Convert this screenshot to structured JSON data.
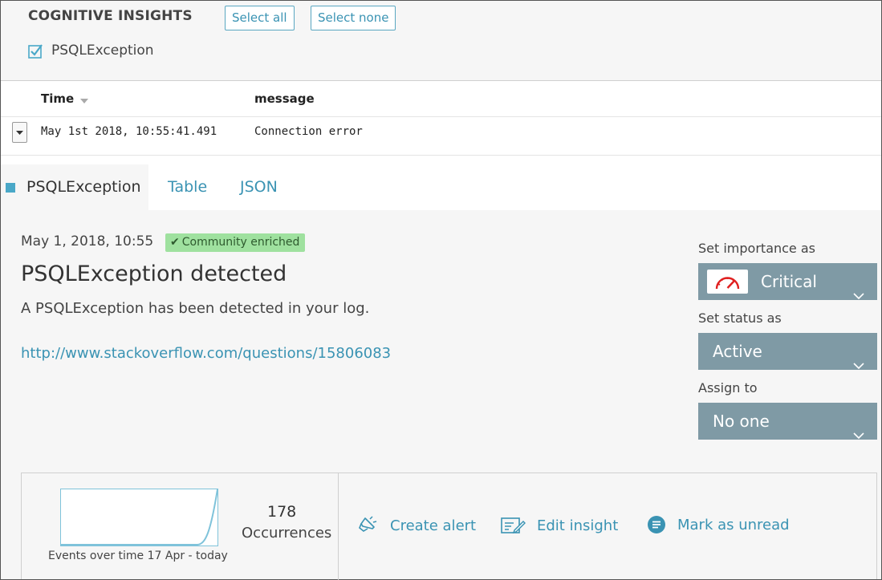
{
  "header": {
    "title": "COGNITIVE INSIGHTS",
    "select_all": "Select all",
    "select_none": "Select none",
    "filter_label": "PSQLException",
    "filter_checked": true
  },
  "log": {
    "columns": {
      "time": "Time",
      "message": "message"
    },
    "row": {
      "time": "May 1st 2018, 10:55:41.491",
      "message": "Connection error"
    }
  },
  "tabs": [
    {
      "label": "PSQLException",
      "active": true
    },
    {
      "label": "Table",
      "active": false
    },
    {
      "label": "JSON",
      "active": false
    }
  ],
  "insight": {
    "date": "May 1, 2018, 10:55",
    "badge": "Community enriched",
    "title": "PSQLException detected",
    "description": "A PSQLException has been detected in your log.",
    "link": "http://www.stackoverflow.com/questions/15806083"
  },
  "sidebar": {
    "importance_label": "Set importance as",
    "importance_value": "Critical",
    "status_label": "Set status as",
    "status_value": "Active",
    "assign_label": "Assign to",
    "assign_value": "No one"
  },
  "stats": {
    "caption": "Events over time 17 Apr - today",
    "occurrences_count": "178",
    "occurrences_label": "Occurrences"
  },
  "actions": {
    "create_alert": "Create alert",
    "edit_insight": "Edit insight",
    "mark_unread": "Mark as unread"
  },
  "colors": {
    "accent": "#3a93b3",
    "select_bg": "#7f9aa5",
    "badge_bg": "#9fe19f",
    "critical_red": "#e02020"
  }
}
